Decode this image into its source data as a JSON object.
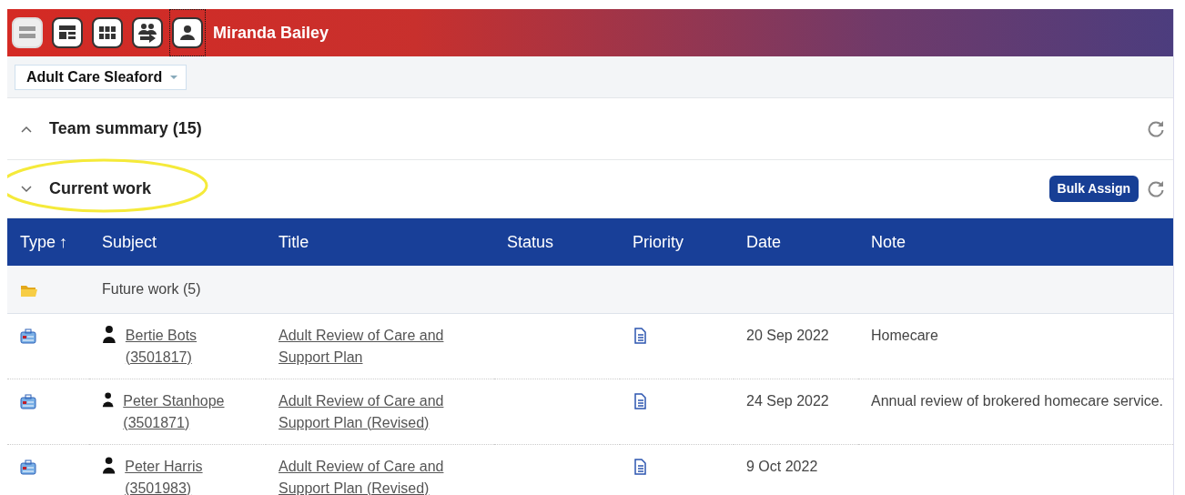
{
  "header": {
    "toolbar": [
      {
        "disabled": true,
        "focused": false
      },
      {
        "disabled": false,
        "focused": false
      },
      {
        "disabled": false,
        "focused": false
      },
      {
        "disabled": false,
        "focused": false
      },
      {
        "disabled": false,
        "focused": true
      }
    ],
    "user_name": "Miranda Bailey"
  },
  "team_selector": {
    "value": "Adult Care Sleaford"
  },
  "sections": [
    {
      "title": "Team summary (15)",
      "expanded": false,
      "highlighted": false
    },
    {
      "title": "Current work",
      "expanded": true,
      "highlighted": true,
      "actions": [
        "Bulk Assign"
      ]
    }
  ],
  "table": {
    "columns": [
      {
        "label": "Type",
        "sorted": true
      },
      {
        "label": "Subject",
        "sorted": false
      },
      {
        "label": "Title",
        "sorted": false
      },
      {
        "label": "Status",
        "sorted": false
      },
      {
        "label": "Priority",
        "sorted": false
      },
      {
        "label": "Date",
        "sorted": false
      },
      {
        "label": "Note",
        "sorted": false
      }
    ],
    "sort_arrow": "↑",
    "rows": [
      {
        "kind": "group",
        "label": "Future work (5)"
      },
      {
        "kind": "item",
        "subject": "Bertie Bots (3501817)",
        "title": "Adult Review of Care and Support Plan",
        "date": "20 Sep 2022",
        "note": "Homecare"
      },
      {
        "kind": "item",
        "subject": "Peter Stanhope (3501871)",
        "title": "Adult Review of Care and Support Plan (Revised)",
        "date": "24 Sep 2022",
        "note": "Annual review of brokered homecare service."
      },
      {
        "kind": "item",
        "subject": "Peter Harris (3501983)",
        "title": "Adult Review of Care and Support Plan (Revised)",
        "date": "9 Oct 2022"
      }
    ]
  }
}
